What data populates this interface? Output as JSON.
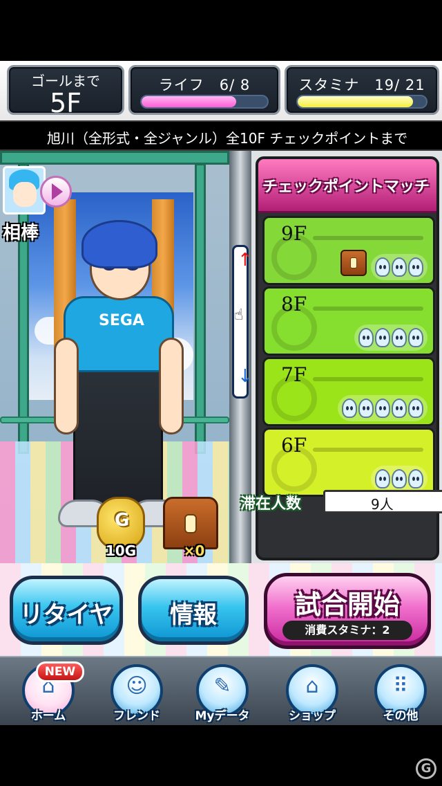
{
  "header": {
    "goal_label": "ゴールまで",
    "goal_value": "5F",
    "life_label": "ライフ　6/ 8",
    "life_ratio": 0.75,
    "stamina_label": "スタミナ　19/ 21",
    "stamina_ratio": 0.9
  },
  "ticker": {
    "text": "旭川（全形式・全ジャンル）全10F チェックポイントまで"
  },
  "stage": {
    "partner_label": "相棒",
    "gold_icon_letter": "G",
    "gold_count": "10G",
    "chest_count": "×0",
    "shirt_logo": "SEGA"
  },
  "floor_panel": {
    "title": "チェックポイントマッチ",
    "floors": [
      {
        "label": "9F",
        "players": 3,
        "has_chest": true,
        "color": "#84d838"
      },
      {
        "label": "8F",
        "players": 4,
        "has_chest": false,
        "color": "#86df2f"
      },
      {
        "label": "7F",
        "players": 5,
        "has_chest": false,
        "color": "#9be41a"
      },
      {
        "label": "6F",
        "players": 3,
        "has_chest": false,
        "color": "#d4f028"
      }
    ],
    "occupancy_label": "滞在人数",
    "occupancy_value": "9人"
  },
  "actions": {
    "retire_label": "リタイヤ",
    "info_label": "情報",
    "start_label": "試合開始",
    "start_cost": "消費スタミナ：2"
  },
  "nav": {
    "new_badge": "NEW",
    "items": [
      {
        "label": "ホーム",
        "icon": "home-icon",
        "glyph": "⌂"
      },
      {
        "label": "フレンド",
        "icon": "friend-icon",
        "glyph": "☺"
      },
      {
        "label": "Myデータ",
        "icon": "mydata-icon",
        "glyph": "✎"
      },
      {
        "label": "ショップ",
        "icon": "shop-icon",
        "glyph": "⌂"
      },
      {
        "label": "その他",
        "icon": "other-icon",
        "glyph": "⠿"
      }
    ]
  },
  "watermark": "G"
}
